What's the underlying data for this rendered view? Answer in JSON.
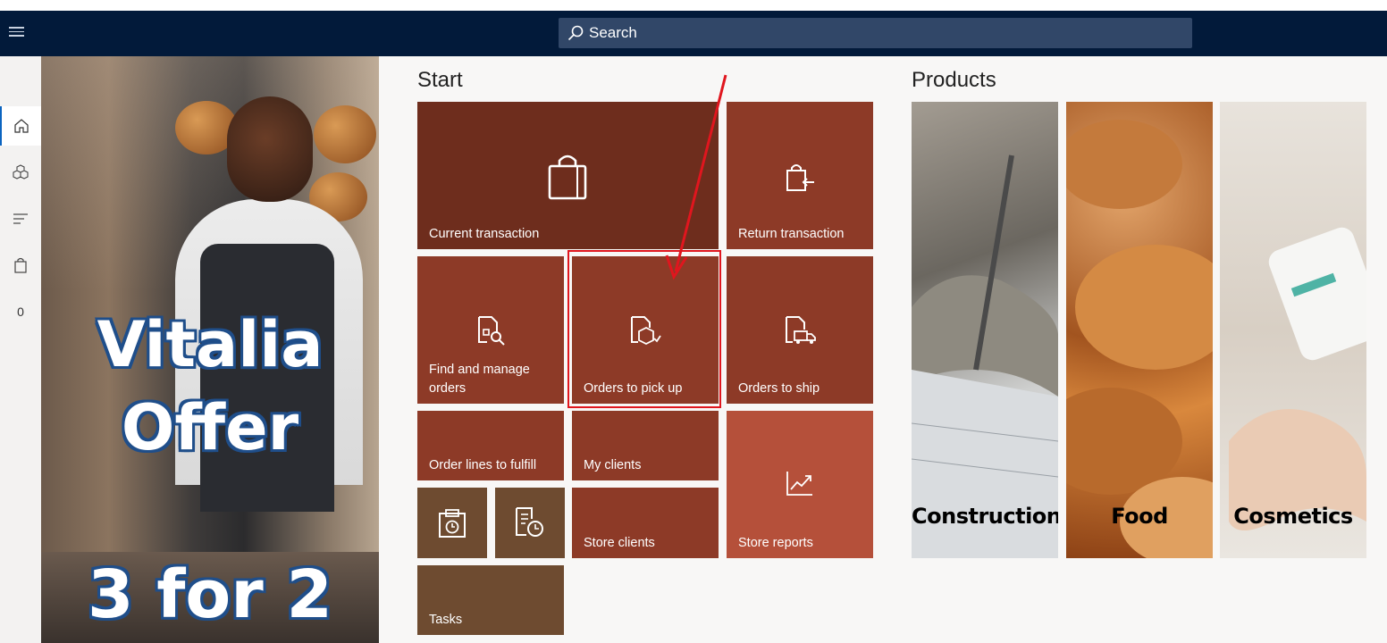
{
  "topbar": {
    "search_label": "Search",
    "background": "#021a3a"
  },
  "leftnav": {
    "items": [
      {
        "icon": "home-icon"
      },
      {
        "icon": "products-icon"
      },
      {
        "icon": "list-icon"
      },
      {
        "icon": "bag-icon"
      }
    ],
    "cart_count": "0"
  },
  "promo": {
    "line1": "Vitalia",
    "line2": "Offer",
    "line3": "3 for 2"
  },
  "start": {
    "title": "Start",
    "tiles": {
      "current_transaction": "Current transaction",
      "return_transaction": "Return transaction",
      "find_manage_orders": "Find and manage orders",
      "orders_to_pick_up": "Orders to pick up",
      "orders_to_ship": "Orders to ship",
      "order_lines_to_fulfill": "Order lines to fulfill",
      "my_clients": "My clients",
      "store_clients": "Store clients",
      "store_reports": "Store reports",
      "tasks": "Tasks"
    }
  },
  "products": {
    "title": "Products",
    "items": [
      "Construction",
      "Food",
      "Cosmetics"
    ]
  },
  "colors": {
    "tile_dark": "#6e2d1d",
    "tile_mid": "#8d3a27",
    "tile_light": "#b5503a",
    "tile_brown": "#6e4b30",
    "annotation": "#e0161e"
  }
}
